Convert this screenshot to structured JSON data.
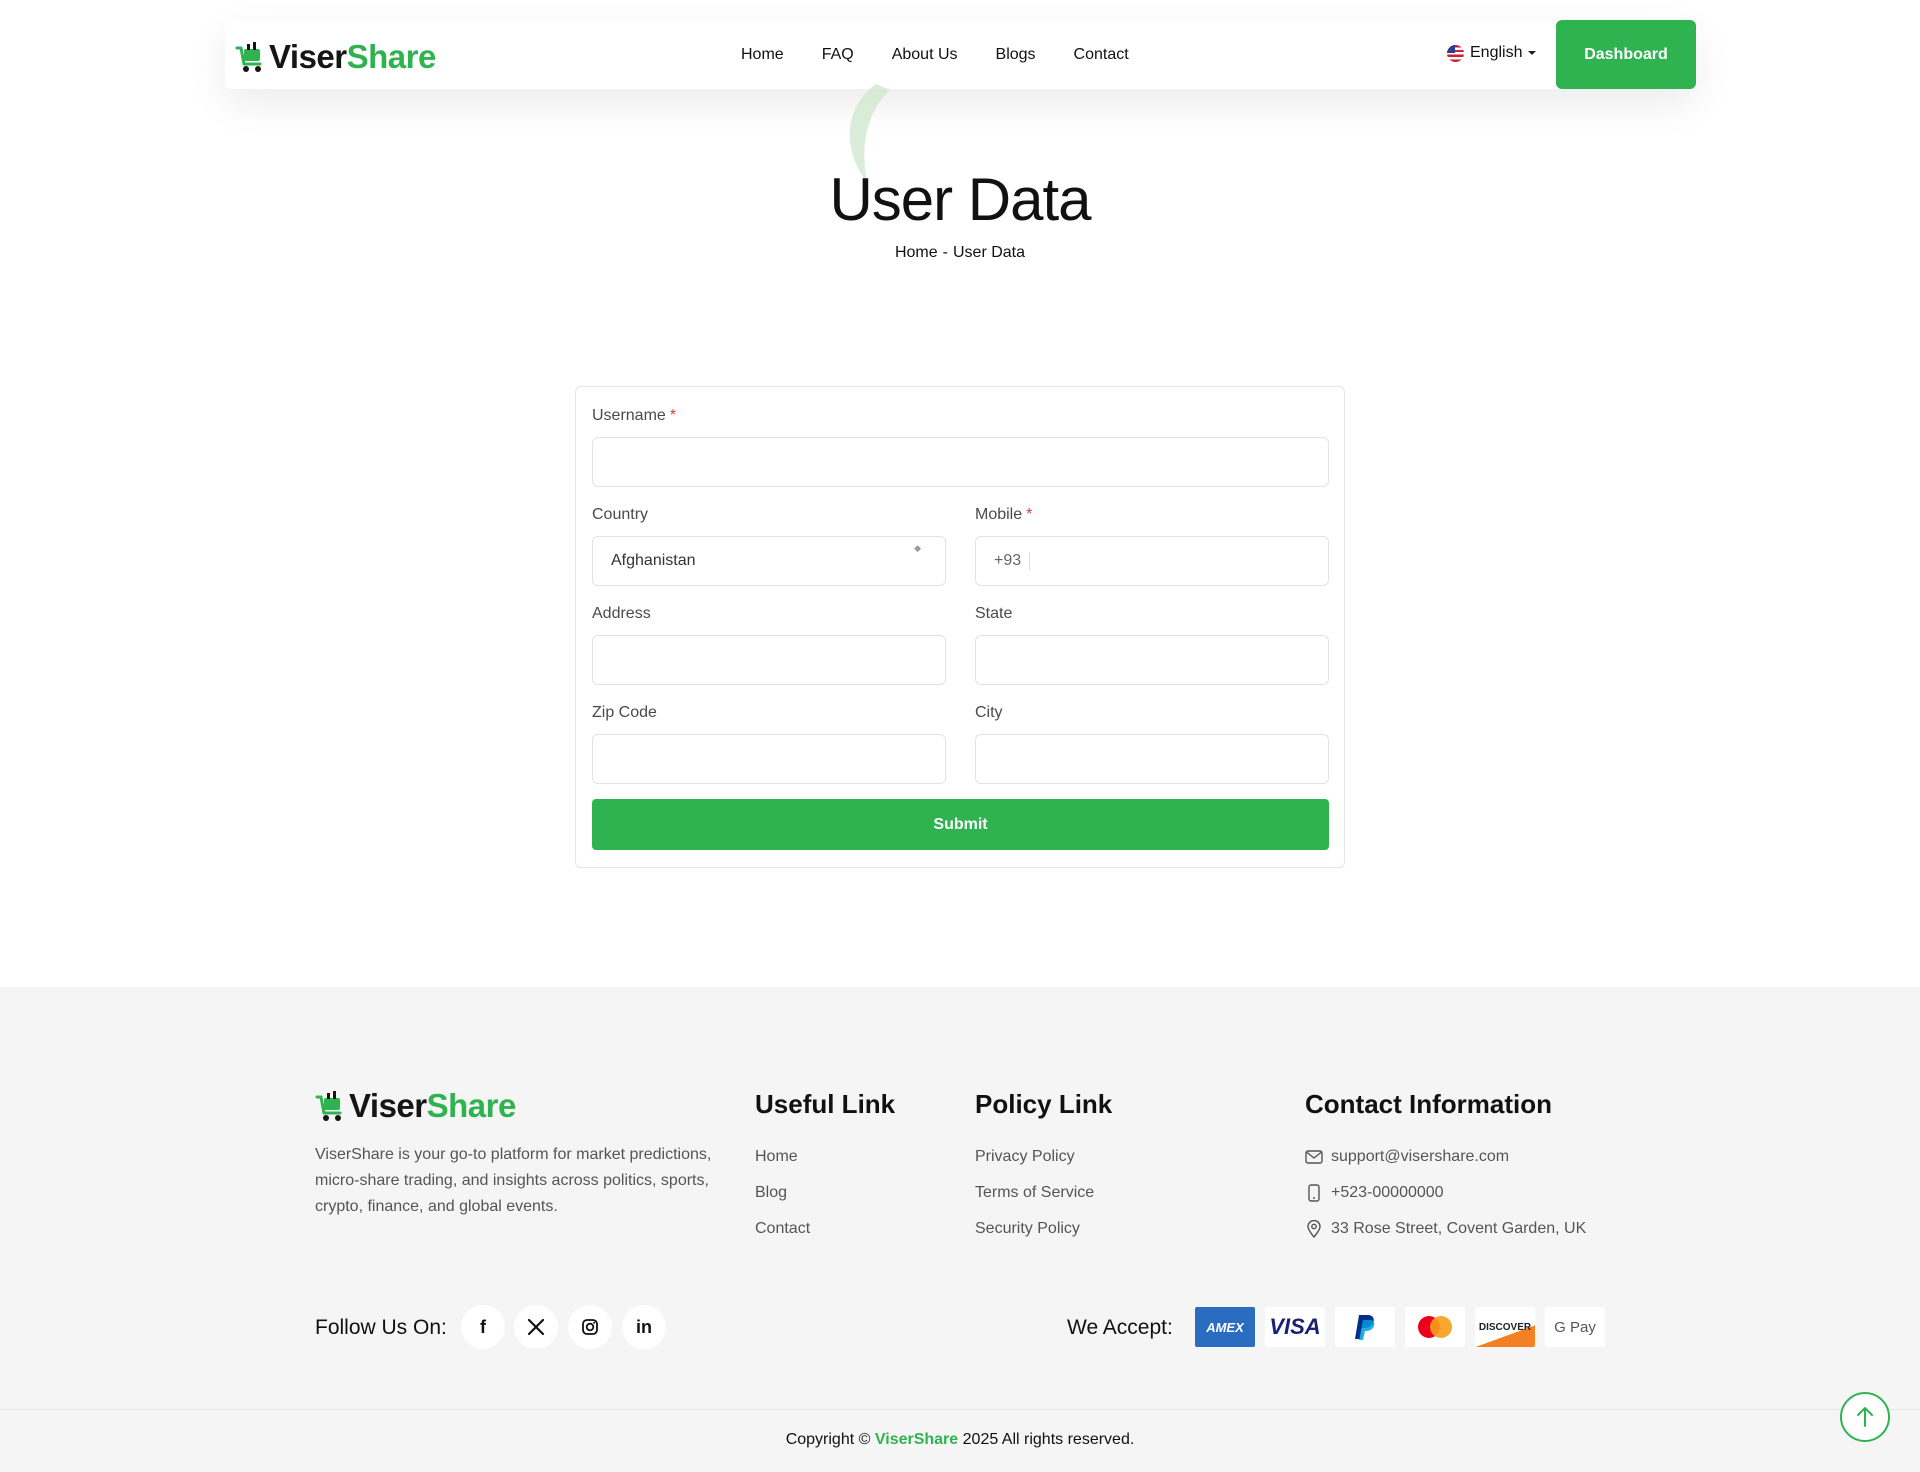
{
  "brand": {
    "part1": "Viser",
    "part2": "Share",
    "accent": "#2fb351"
  },
  "nav": {
    "items": [
      "Home",
      "FAQ",
      "About Us",
      "Blogs",
      "Contact"
    ]
  },
  "language": {
    "selected": "English"
  },
  "dashboard_label": "Dashboard",
  "page": {
    "title": "User Data",
    "breadcrumb": {
      "home": "Home",
      "separator": "-",
      "current": "User Data"
    }
  },
  "form": {
    "username": {
      "label": "Username",
      "value": ""
    },
    "country": {
      "label": "Country",
      "value": "Afghanistan"
    },
    "mobile": {
      "label": "Mobile",
      "code": "+93",
      "value": ""
    },
    "address": {
      "label": "Address",
      "value": ""
    },
    "state": {
      "label": "State",
      "value": ""
    },
    "zip": {
      "label": "Zip Code",
      "value": ""
    },
    "city": {
      "label": "City",
      "value": ""
    },
    "submit_label": "Submit",
    "required_mark": "*"
  },
  "footer": {
    "description": "ViserShare is your go-to platform for market predictions, micro-share trading, and insights across politics, sports, crypto, finance, and global events.",
    "useful": {
      "title": "Useful Link",
      "links": [
        "Home",
        "Blog",
        "Contact"
      ]
    },
    "policy": {
      "title": "Policy Link",
      "links": [
        "Privacy Policy",
        "Terms of Service",
        "Security Policy"
      ]
    },
    "contact": {
      "title": "Contact Information",
      "email": "support@visershare.com",
      "phone": "+523-00000000",
      "address": "33 Rose Street, Covent Garden, UK"
    },
    "follow_label": "Follow Us On:",
    "social": [
      "facebook-icon",
      "x-icon",
      "instagram-icon",
      "linkedin-icon"
    ],
    "accept_label": "We Accept:",
    "payments": [
      "AMEX",
      "VISA",
      "PayPal",
      "Mastercard",
      "DISCOVER",
      "G Pay"
    ],
    "copyright": {
      "prefix": "Copyright ©",
      "brand": "ViserShare",
      "suffix": "2025 All rights reserved."
    }
  }
}
